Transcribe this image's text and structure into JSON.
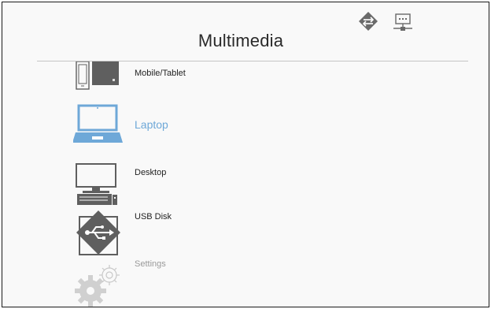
{
  "header": {
    "title": "Multimedia",
    "status_icons": [
      "network-icon",
      "lan-icon"
    ]
  },
  "menu": {
    "items": [
      {
        "label": "Mobile/Tablet",
        "icon": "mobile-tablet-icon"
      },
      {
        "label": "Laptop",
        "icon": "laptop-icon",
        "selected": true
      },
      {
        "label": "Desktop",
        "icon": "desktop-icon"
      },
      {
        "label": "USB Disk",
        "icon": "usb-disk-icon"
      },
      {
        "label": "Settings",
        "icon": "settings-gear-icon",
        "dimmed": true
      }
    ]
  },
  "colors": {
    "selected": "#6ea8d8",
    "icon": "#5f5f5f",
    "dim": "#c8c8c8"
  }
}
